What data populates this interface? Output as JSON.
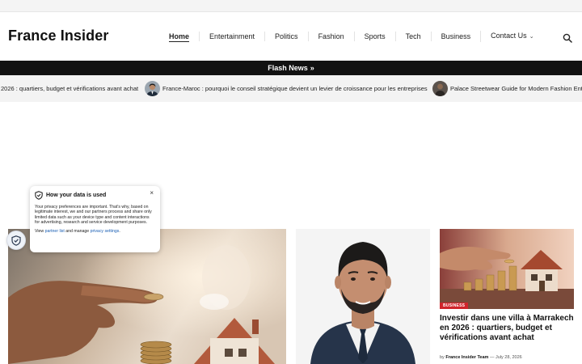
{
  "site": {
    "logo": "France Insider"
  },
  "nav": {
    "items": [
      {
        "label": "Home"
      },
      {
        "label": "Entertainment"
      },
      {
        "label": "Politics"
      },
      {
        "label": "Fashion"
      },
      {
        "label": "Sports"
      },
      {
        "label": "Tech"
      },
      {
        "label": "Business"
      },
      {
        "label": "Contact Us"
      }
    ]
  },
  "flash": {
    "label": "Flash News",
    "arrow": "»"
  },
  "ticker": {
    "items": [
      {
        "text": "2026 : quartiers, budget et vérifications avant achat"
      },
      {
        "text": "France-Maroc : pourquoi le conseil stratégique devient un levier de croissance pour les entreprises"
      },
      {
        "text": "Palace Streetwear Guide for Modern Fashion Enth"
      }
    ]
  },
  "privacy": {
    "title": "How your data is used",
    "body": "Your privacy preferences are important. That's why, based on legitimate interest, we and our partners process and share only limited data such as your device type and content interactions for advertising, research and service development purposes.",
    "links_prefix": "View",
    "partner_link": "partner list",
    "links_middle": "and manage",
    "settings_link": "privacy settings",
    "links_suffix": ".",
    "close": "×"
  },
  "side_article": {
    "category": "BUSINESS",
    "title": "Investir dans une villa à Marrakech en 2026 : quartiers, budget et vérifications avant achat",
    "meta_prefix": "by",
    "author": "France Insider Team",
    "separator": "—",
    "date": "July 28, 2026"
  },
  "colors": {
    "flash_bg": "#111111",
    "badge_red": "#d0242b",
    "link_blue": "#1a5fb4"
  },
  "icons": {
    "search": "search-icon",
    "privacy": "shield-check-icon",
    "dropdown": "chevron-down-icon",
    "flash": "double-chevron-right-icon"
  }
}
